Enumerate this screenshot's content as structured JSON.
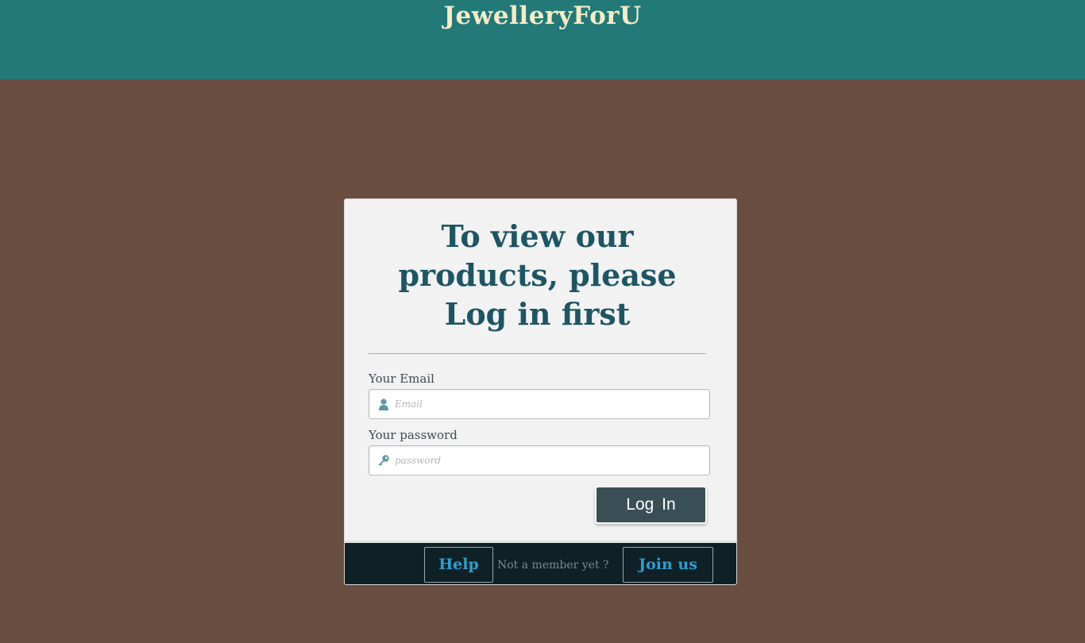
{
  "header": {
    "site_title": "JewelleryForU"
  },
  "login_card": {
    "heading": "To view our products, please Log in first",
    "email": {
      "label": "Your Email",
      "placeholder": "Email",
      "icon": "user-icon",
      "value": ""
    },
    "password": {
      "label": "Your password",
      "placeholder": "password",
      "icon": "key-icon",
      "value": ""
    },
    "login_button_label": "Log In"
  },
  "footer": {
    "help_label": "Help",
    "member_prompt": "Not a member yet ?",
    "join_label": "Join us"
  },
  "colors": {
    "header_bg": "#227978",
    "page_bg": "#694d40",
    "title_color": "#f6ebc8",
    "heading_color": "#1d5562",
    "button_bg": "#3a4e55",
    "footer_bg": "#0f2127",
    "link_color": "#2f9ed0"
  }
}
